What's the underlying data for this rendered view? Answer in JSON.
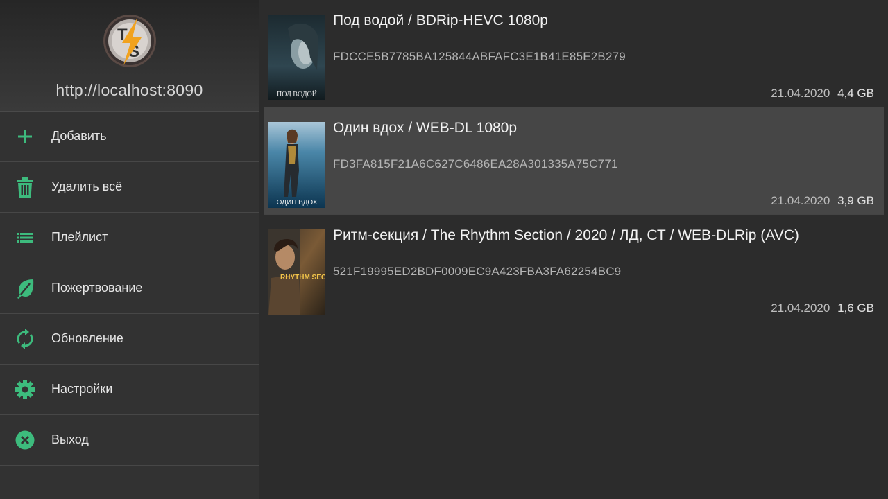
{
  "sidebar": {
    "server_url": "http://localhost:8090",
    "logo_text": "TS",
    "items": [
      {
        "label": "Добавить",
        "icon": "plus-icon"
      },
      {
        "label": "Удалить всё",
        "icon": "trash-icon"
      },
      {
        "label": "Плейлист",
        "icon": "list-icon"
      },
      {
        "label": "Пожертвование",
        "icon": "leaf-icon"
      },
      {
        "label": "Обновление",
        "icon": "refresh-icon"
      },
      {
        "label": "Настройки",
        "icon": "gear-icon"
      },
      {
        "label": "Выход",
        "icon": "close-circle-icon"
      }
    ]
  },
  "torrents": [
    {
      "title": "Под водой / BDRip-HEVC 1080p",
      "hash": "FDCCE5B7785BA125844ABFAFC3E1B41E85E2B279",
      "date": "21.04.2020",
      "size": "4,4 GB",
      "poster_caption": "ПОД ВОДОЙ"
    },
    {
      "title": "Один вдох / WEB-DL 1080p",
      "hash": "FD3FA815F21A6C627C6486EA28A301335A75C771",
      "date": "21.04.2020",
      "size": "3,9 GB",
      "poster_caption": "ОДИН ВДОХ"
    },
    {
      "title": "Ритм-секция / The Rhythm Section / 2020 / ЛД, СТ / WEB-DLRip (AVC)",
      "hash": "521F19995ED2BDF0009EC9A423FBA3FA62254BC9",
      "date": "21.04.2020",
      "size": "1,6 GB",
      "poster_caption": "RHYTHM SECTION"
    }
  ],
  "colors": {
    "accent": "#3dbb7d",
    "sidebar_bg": "#323232",
    "list_bg": "#2c2c2c",
    "selected_bg": "#464646"
  }
}
